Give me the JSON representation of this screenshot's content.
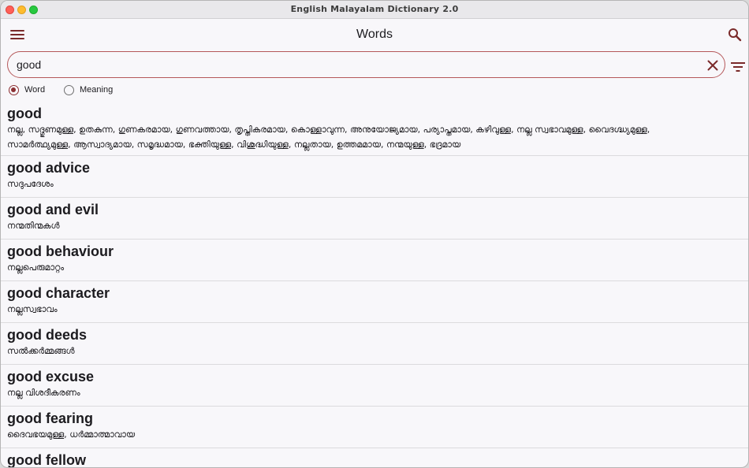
{
  "window": {
    "title": "English Malayalam Dictionary 2.0"
  },
  "appbar": {
    "title": "Words",
    "menu_icon": "hamburger-menu-icon",
    "search_icon": "search-icon"
  },
  "search": {
    "value": "good",
    "clear_icon": "close-icon",
    "filter_icon": "filter-icon"
  },
  "radio": {
    "word_label": "Word",
    "meaning_label": "Meaning",
    "selected": "Word"
  },
  "colors": {
    "accent": "#8c2f32",
    "border": "#b5585a",
    "background": "#f8f7fa"
  },
  "entries": [
    {
      "word": "good",
      "meaning": "നല്ല, സദ്ഗുണമുള്ള, ഉതകുന്ന, ഗുണകരമായ, ഗുണവത്തായ, തൃപ്തികരമായ, കൊള്ളാവുന്ന, അനുയോജ്യമായ, പര്യാപ്തമായ, കഴിവുള്ള, നല്ല സ്വഭാവമുള്ള, വൈദഗ്ദ്ധ്യമുള്ള, സാമർത്ഥ്യമുള്ള, ആസ്വാദ്യമായ, സമൃദ്ധമായ, ഭക്തിയുള്ള, വിശുദ്ധിയുള്ള, നല്ലതായ, ഉത്തമമായ, നന്മയുള്ള, ഭദ്രമായ"
    },
    {
      "word": "good advice",
      "meaning": "സദുപദേശം"
    },
    {
      "word": "good and evil",
      "meaning": "നന്മതിന്മകൾ"
    },
    {
      "word": "good behaviour",
      "meaning": "നല്ലപെരുമാറ്റം"
    },
    {
      "word": "good character",
      "meaning": "നല്ലസ്വഭാവം"
    },
    {
      "word": "good deeds",
      "meaning": "സൽക്കർമ്മങ്ങൾ"
    },
    {
      "word": "good excuse",
      "meaning": "നല്ല വിശദീകരണം"
    },
    {
      "word": "good fearing",
      "meaning": "ദൈവഭയമുള്ള, ധർമ്മാത്മാവായ"
    },
    {
      "word": "good fellow",
      "meaning": ""
    }
  ]
}
